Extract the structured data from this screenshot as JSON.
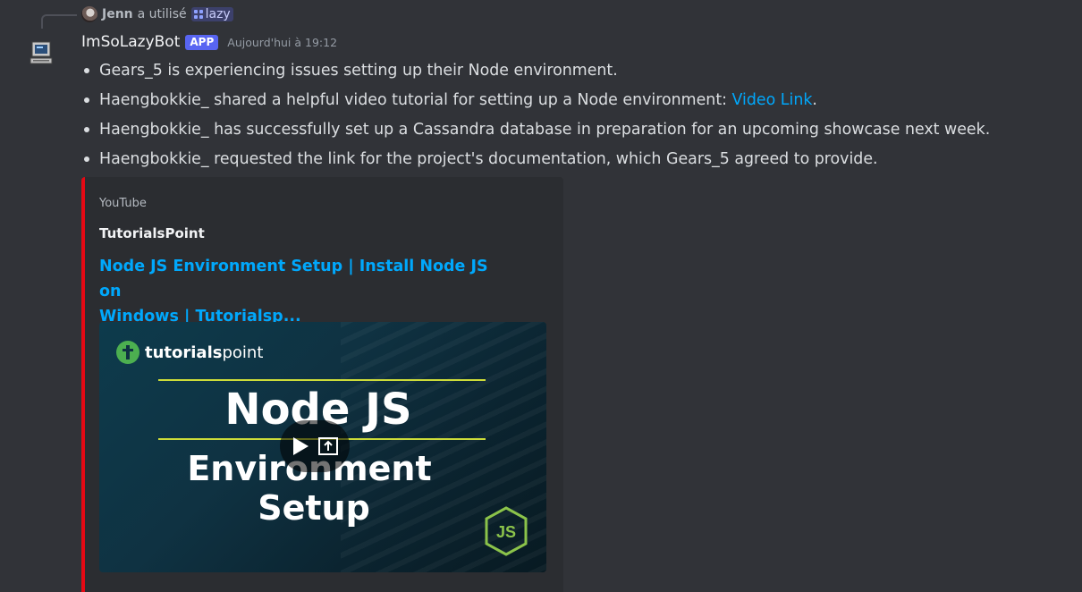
{
  "reply": {
    "user": "Jenn",
    "action": "a utilisé",
    "command": "lazy"
  },
  "message": {
    "username": "ImSoLazyBot",
    "badge": "APP",
    "timestamp": "Aujourd'hui à 19:12",
    "bullets": [
      {
        "text": "Gears_5 is experiencing issues setting up their Node environment."
      },
      {
        "text": "Haengbokkie_ shared a helpful video tutorial for setting up a Node environment: ",
        "link": "Video Link",
        "after": "."
      },
      {
        "text": "Haengbokkie_ has successfully set up a Cassandra database in preparation for an upcoming showcase next week."
      },
      {
        "text": "Haengbokkie_ requested the link for the project's documentation, which Gears_5 agreed to provide."
      }
    ]
  },
  "embed": {
    "provider": "YouTube",
    "author": "TutorialsPoint",
    "title_line1": "Node JS Environment Setup | Install Node JS on",
    "title_line2": "Windows | Tutorialsp...",
    "accent_color": "#e50914",
    "thumbnail": {
      "brand_bold": "tutorials",
      "brand_light": "point",
      "heading": "Node JS",
      "sub1": "Environment",
      "sub2": "Setup"
    }
  },
  "colors": {
    "background": "#313338",
    "link": "#00a8fc",
    "badge": "#5865f2"
  },
  "icons": [
    "reply-avatar-icon",
    "slash-command-icon",
    "bot-computer-icon",
    "play-icon",
    "popout-icon",
    "nodejs-icon",
    "tutorialspoint-logo-icon"
  ]
}
